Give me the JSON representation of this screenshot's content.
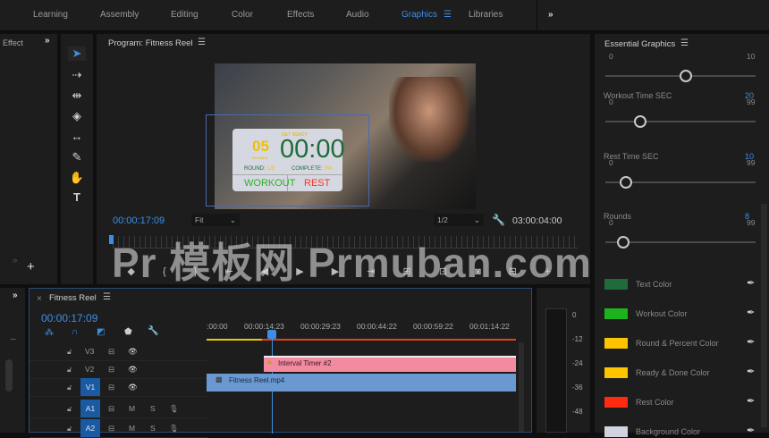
{
  "workspaces": [
    "Learning",
    "Assembly",
    "Editing",
    "Color",
    "Effects",
    "Audio",
    "Graphics",
    "Libraries"
  ],
  "active_workspace": "Graphics",
  "effect_panel": {
    "title": "Effect"
  },
  "program": {
    "title": "Program: Fitness Reel",
    "timecode": "00:00:17:09",
    "zoom": "Fit",
    "resolution": "1/2",
    "duration": "03:00:04:00"
  },
  "graphic": {
    "rounds": "05",
    "rounds_label": "ROUNDS",
    "top_label": "GET READY",
    "timer": "00:00",
    "round_label": "ROUND:",
    "round_val": "1/8",
    "complete_label": "COMPLETE:",
    "complete_val": "0%",
    "workout": "WORKOUT",
    "rest": "REST"
  },
  "essential_graphics": {
    "title": "Essential Graphics",
    "sliders": [
      {
        "label": "",
        "value": "",
        "min": "0",
        "max": "10",
        "fraction": 0.52
      },
      {
        "label": "Workout Time SEC",
        "value": "20",
        "min": "0",
        "max": "99",
        "fraction": 0.2
      },
      {
        "label": "Rest Time SEC",
        "value": "10",
        "min": "0",
        "max": "99",
        "fraction": 0.1
      },
      {
        "label": "Rounds",
        "value": "8",
        "min": "0",
        "max": "99",
        "fraction": 0.08
      }
    ],
    "colors": [
      {
        "label": "Text Color",
        "color": "#1f6b3a"
      },
      {
        "label": "Workout Color",
        "color": "#1db31d"
      },
      {
        "label": "Round & Percent Color",
        "color": "#ffc400"
      },
      {
        "label": "Ready & Done Color",
        "color": "#ffc400"
      },
      {
        "label": "Rest Color",
        "color": "#ff2a10"
      },
      {
        "label": "Background Color",
        "color": "#d0d4de"
      }
    ]
  },
  "timeline": {
    "title": "Fitness Reel",
    "timecode": "00:00:17:09",
    "ruler": [
      ":00:00",
      "00:00:14:23",
      "00:00:29:23",
      "00:00:44:22",
      "00:00:59:22",
      "00:01:14:22"
    ],
    "tracks": [
      "V3",
      "V2",
      "V1",
      "A1",
      "A2"
    ],
    "mute": "M",
    "solo": "S",
    "clips": {
      "v2": "Interval Timer #2",
      "v1": "Fitness Reel.mp4"
    }
  },
  "meter": [
    "0",
    "-12",
    "-24",
    "-36",
    "-48"
  ],
  "watermark": "Pr 模板网 Prmuban.com"
}
